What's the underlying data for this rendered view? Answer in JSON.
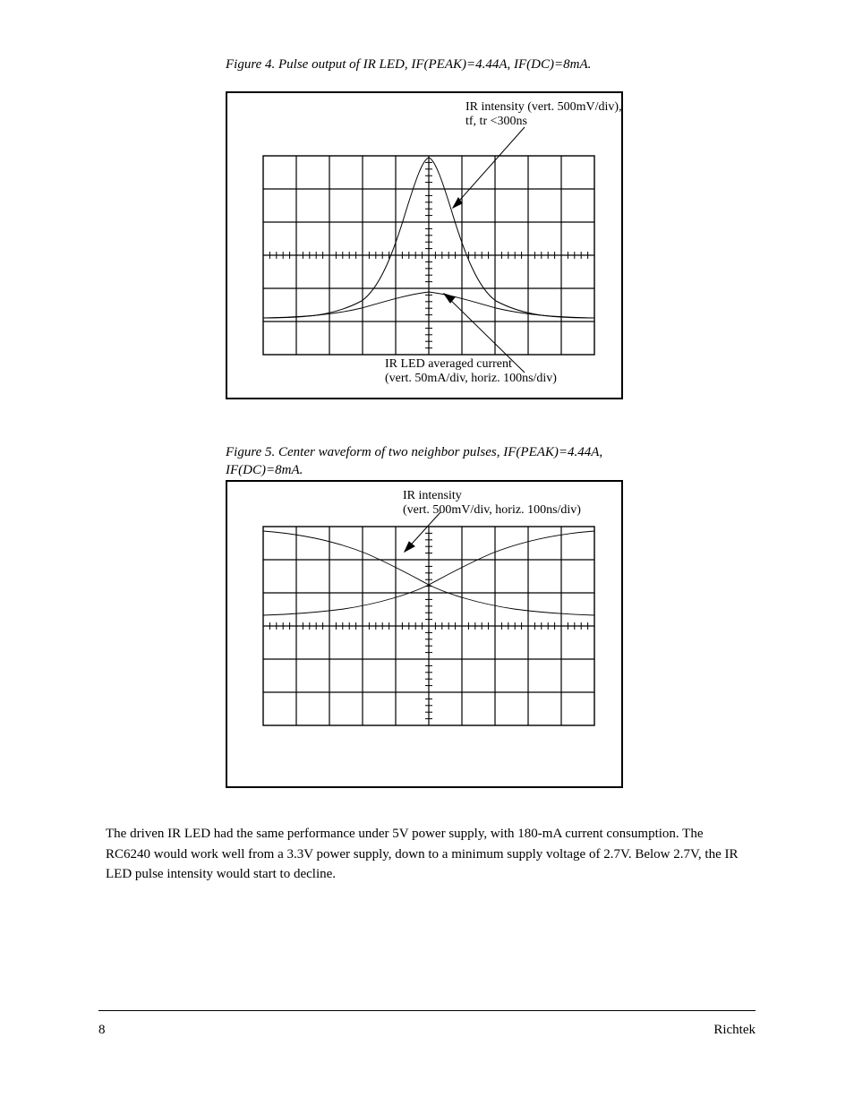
{
  "fig1": {
    "caption": "Figure 4. Pulse output of IR LED,\nIF(PEAK)=4.44A, IF(DC)=8mA.",
    "label_top": "IR intensity (vert. 500mV/div),\ntf, tr <300ns",
    "label_bottom": "IR LED averaged current\n(vert. 50mA/div, horiz. 100ns/div)",
    "chart_data": {
      "type": "line",
      "x_unit": "ns",
      "x_per_div": 100,
      "x_range_divs": 10,
      "y_center_div": 3,
      "series": [
        {
          "name": "IR intensity",
          "vert_div_mV": 500,
          "points": [
            {
              "div_x": -5.0,
              "div_y": 0.1
            },
            {
              "div_x": -4.0,
              "div_y": 0.12
            },
            {
              "div_x": -3.0,
              "div_y": 0.2
            },
            {
              "div_x": -2.5,
              "div_y": 0.35
            },
            {
              "div_x": -2.0,
              "div_y": 0.7
            },
            {
              "div_x": -1.5,
              "div_y": 1.3
            },
            {
              "div_x": -1.0,
              "div_y": 2.1
            },
            {
              "div_x": -0.5,
              "div_y": 2.8
            },
            {
              "div_x": 0.0,
              "div_y": 3.0
            },
            {
              "div_x": 0.5,
              "div_y": 2.8
            },
            {
              "div_x": 1.0,
              "div_y": 2.1
            },
            {
              "div_x": 1.5,
              "div_y": 1.3
            },
            {
              "div_x": 2.0,
              "div_y": 0.7
            },
            {
              "div_x": 2.5,
              "div_y": 0.35
            },
            {
              "div_x": 3.0,
              "div_y": 0.2
            },
            {
              "div_x": 4.0,
              "div_y": 0.12
            },
            {
              "div_x": 5.0,
              "div_y": 0.1
            }
          ]
        },
        {
          "name": "IR LED averaged current",
          "vert_div_mA": 50,
          "points": [
            {
              "div_x": -5.0,
              "div_y": 0.1
            },
            {
              "div_x": -4.0,
              "div_y": 0.12
            },
            {
              "div_x": -3.0,
              "div_y": 0.22
            },
            {
              "div_x": -2.0,
              "div_y": 0.4
            },
            {
              "div_x": -1.0,
              "div_y": 0.68
            },
            {
              "div_x": -0.5,
              "div_y": 0.77
            },
            {
              "div_x": 0.0,
              "div_y": 0.8
            },
            {
              "div_x": 0.5,
              "div_y": 0.77
            },
            {
              "div_x": 1.0,
              "div_y": 0.68
            },
            {
              "div_x": 2.0,
              "div_y": 0.4
            },
            {
              "div_x": 3.0,
              "div_y": 0.22
            },
            {
              "div_x": 4.0,
              "div_y": 0.12
            },
            {
              "div_x": 5.0,
              "div_y": 0.1
            }
          ]
        }
      ]
    }
  },
  "fig2": {
    "caption": "Figure 5. Center waveform of two neighbor\npulses, IF(PEAK)=4.44A, IF(DC)=8mA.",
    "label": "IR intensity\n(vert. 500mV/div, horiz. 100ns/div)",
    "chart_data": {
      "type": "line",
      "x_unit": "ns",
      "x_per_div": 100,
      "x_range_divs": 10,
      "y_center_div": 3,
      "series": [
        {
          "name": "falling pulse tail",
          "points": [
            {
              "div_x": -5.0,
              "div_y": 2.65
            },
            {
              "div_x": -4.0,
              "div_y": 2.5
            },
            {
              "div_x": -3.0,
              "div_y": 2.25
            },
            {
              "div_x": -2.0,
              "div_y": 1.9
            },
            {
              "div_x": -1.0,
              "div_y": 1.55
            },
            {
              "div_x": 0.0,
              "div_y": 1.3
            },
            {
              "div_x": 1.0,
              "div_y": 1.15
            },
            {
              "div_x": 2.0,
              "div_y": 1.05
            },
            {
              "div_x": 3.0,
              "div_y": 1.0
            },
            {
              "div_x": 4.0,
              "div_y": 0.97
            },
            {
              "div_x": 5.0,
              "div_y": 0.95
            }
          ]
        },
        {
          "name": "rising pulse tail",
          "points": [
            {
              "div_x": -5.0,
              "div_y": 0.95
            },
            {
              "div_x": -4.0,
              "div_y": 0.97
            },
            {
              "div_x": -3.0,
              "div_y": 1.0
            },
            {
              "div_x": -2.0,
              "div_y": 1.05
            },
            {
              "div_x": -1.0,
              "div_y": 1.15
            },
            {
              "div_x": 0.0,
              "div_y": 1.3
            },
            {
              "div_x": 1.0,
              "div_y": 1.55
            },
            {
              "div_x": 2.0,
              "div_y": 1.9
            },
            {
              "div_x": 3.0,
              "div_y": 2.25
            },
            {
              "div_x": 4.0,
              "div_y": 2.5
            },
            {
              "div_x": 5.0,
              "div_y": 2.65
            }
          ]
        }
      ]
    }
  },
  "body": {
    "para": "The driven IR LED had the same performance under 5V power supply, with 180-mA current consumption. The RC6240 would work well from a 3.3V power supply, down to a minimum supply voltage of 2.7V. Below 2.7V, the IR LED pulse intensity would start to decline."
  },
  "footer": {
    "left": "8",
    "right": "Richtek"
  }
}
